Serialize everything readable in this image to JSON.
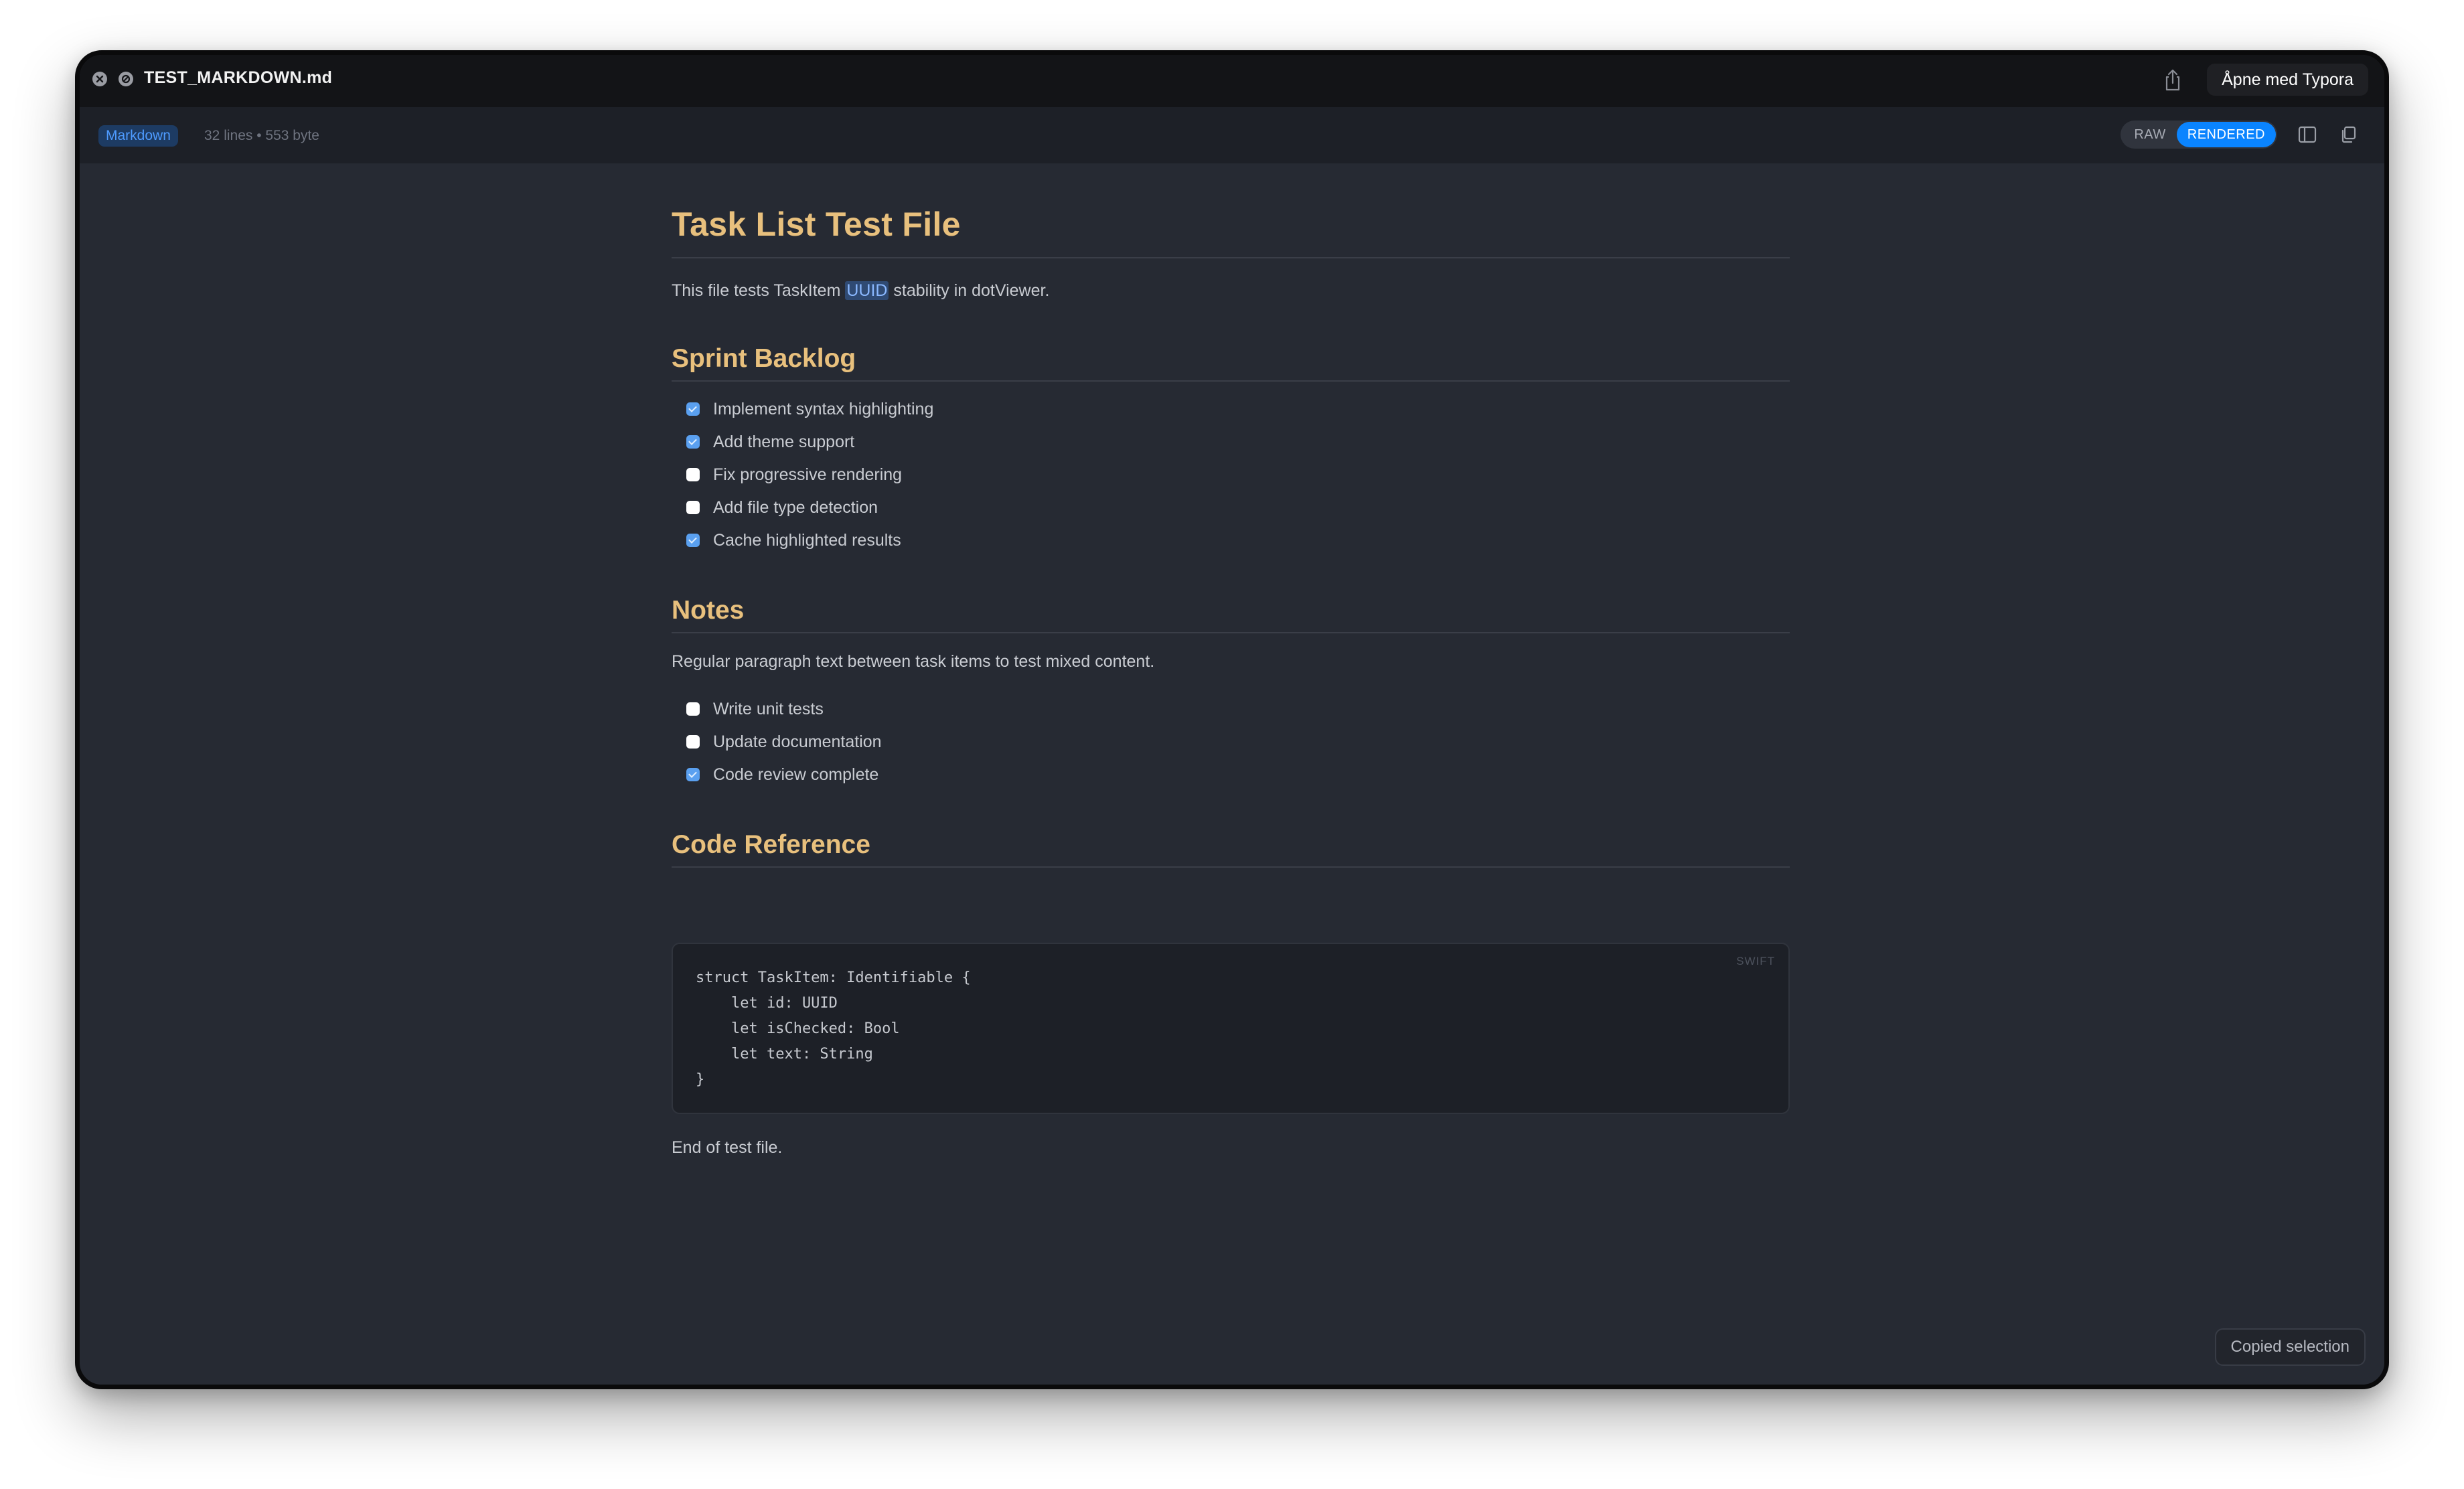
{
  "window": {
    "title": "TEST_MARKDOWN.md",
    "open_with_label": "Åpne med Typora"
  },
  "toolbar": {
    "language": "Markdown",
    "meta": "32 lines • 553 byte",
    "raw_label": "RAW",
    "rendered_label": "RENDERED",
    "active_mode": "RENDERED"
  },
  "document": {
    "title": "Task List Test File",
    "intro_before": "This file tests TaskItem ",
    "intro_highlight": "UUID",
    "intro_after": " stability in dotViewer.",
    "sections": [
      {
        "heading": "Sprint Backlog",
        "tasks": [
          {
            "label": "Implement syntax highlighting",
            "checked": true
          },
          {
            "label": "Add theme support",
            "checked": true
          },
          {
            "label": "Fix progressive rendering",
            "checked": false
          },
          {
            "label": "Add file type detection",
            "checked": false
          },
          {
            "label": "Cache highlighted results",
            "checked": true
          }
        ]
      },
      {
        "heading": "Notes",
        "paragraph": "Regular paragraph text between task items to test mixed content.",
        "tasks": [
          {
            "label": "Write unit tests",
            "checked": false
          },
          {
            "label": "Update documentation",
            "checked": false
          },
          {
            "label": "Code review complete",
            "checked": true
          }
        ]
      },
      {
        "heading": "Code Reference",
        "code": {
          "language": "SWIFT",
          "lines": [
            "struct TaskItem: Identifiable {",
            "    let id: UUID",
            "    let isChecked: Bool",
            "    let text: String",
            "}"
          ]
        }
      }
    ],
    "footer": "End of test file."
  },
  "toast": {
    "message": "Copied selection"
  },
  "colors": {
    "heading": "#e8c07d",
    "accent": "#0a84ff",
    "checkbox_checked": "#5aa0f0",
    "background": "#262a33"
  }
}
